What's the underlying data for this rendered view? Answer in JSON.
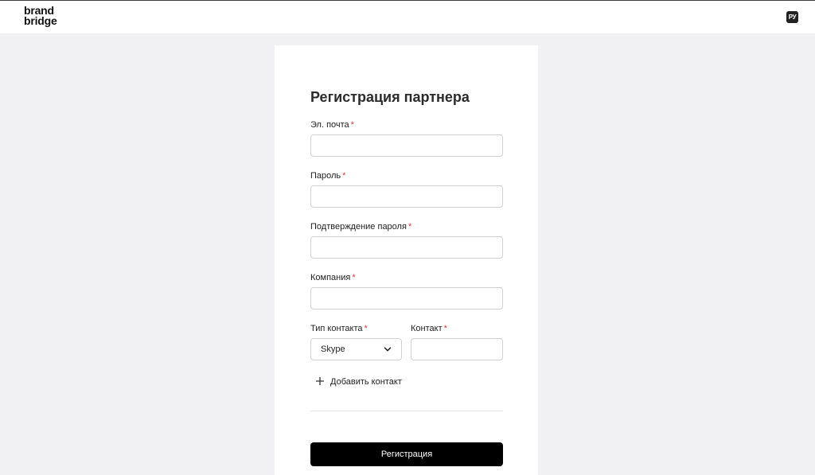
{
  "header": {
    "logo_line1": "brand",
    "logo_line2": "bridge",
    "language": "РУ"
  },
  "form": {
    "title": "Регистрация партнера",
    "required_mark": "*",
    "fields": {
      "email": {
        "label": "Эл. почта",
        "value": ""
      },
      "password": {
        "label": "Пароль",
        "value": ""
      },
      "password_confirm": {
        "label": "Подтверждение пароля",
        "value": ""
      },
      "company": {
        "label": "Компания",
        "value": ""
      },
      "contact_type": {
        "label": "Тип контакта",
        "selected": "Skype"
      },
      "contact": {
        "label": "Контакт",
        "value": ""
      }
    },
    "add_contact_label": "Добавить контакт",
    "submit_label": "Регистрация"
  },
  "colors": {
    "page_bg": "#f1f1f3",
    "card_bg": "#ffffff",
    "required": "#e0343d",
    "button_bg": "#000000",
    "button_text": "#ffffff"
  },
  "icons": {
    "dropdown": "chevron-down-icon",
    "add": "plus-icon"
  }
}
